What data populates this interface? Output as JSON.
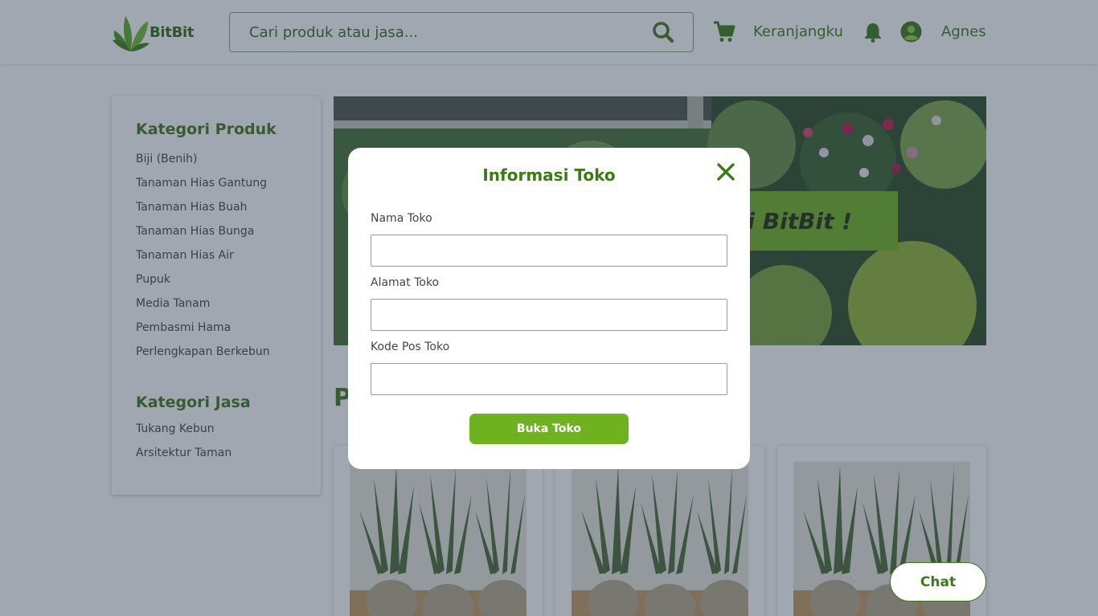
{
  "header": {
    "logo_text": "BitBit",
    "search_placeholder": "Cari produk atau jasa...",
    "cart_label": "Keranjangku",
    "user_name": "Agnes"
  },
  "sidebar": {
    "product_title": "Kategori Produk",
    "product_items": [
      "Biji (Benih)",
      "Tanaman Hias Gantung",
      "Tanaman Hias Buah",
      "Tanaman Hias Bunga",
      "Tanaman Hias Air",
      "Pupuk",
      "Media Tanam",
      "Pembasmi Hama",
      "Perlengkapan Berkebun"
    ],
    "service_title": "Kategori Jasa",
    "service_items": [
      "Tukang Kebun",
      "Arsitektur Taman"
    ]
  },
  "banner": {
    "text": "s di BitBit !"
  },
  "section": {
    "title": "P"
  },
  "chat": {
    "label": "Chat"
  },
  "modal": {
    "title": "Informasi Toko",
    "fields": [
      {
        "label": "Nama Toko",
        "value": ""
      },
      {
        "label": "Alamat Toko",
        "value": ""
      },
      {
        "label": "Kode Pos Toko",
        "value": ""
      }
    ],
    "submit_label": "Buka Toko"
  },
  "colors": {
    "brand_green": "#3d7a17",
    "accent_green": "#6fb21f",
    "overlay": "rgba(45,60,80,.45)"
  },
  "icons": [
    "leaf-logo-icon",
    "search-icon",
    "cart-icon",
    "bell-icon",
    "user-icon",
    "close-icon"
  ]
}
